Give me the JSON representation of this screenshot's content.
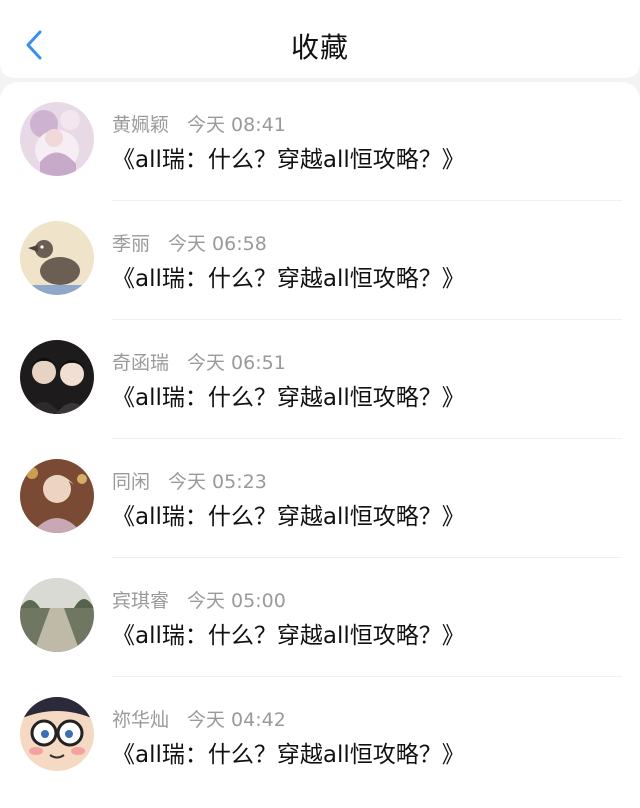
{
  "header": {
    "title": "收藏",
    "back_icon": "chevron-left-icon",
    "accent_color": "#3a8ef0"
  },
  "items": [
    {
      "name": "黄姵颖",
      "time": "今天 08:41",
      "message": "《all瑞：什么？穿越all恒攻略？》",
      "avatar": "anime-girl-pink"
    },
    {
      "name": "季丽",
      "time": "今天 06:58",
      "message": "《all瑞：什么？穿越all恒攻略？》",
      "avatar": "duck-cartoon"
    },
    {
      "name": "奇函瑞",
      "time": "今天 06:51",
      "message": "《all瑞：什么？穿越all恒攻略？》",
      "avatar": "two-people-photo"
    },
    {
      "name": "同闲",
      "time": "今天 05:23",
      "message": "《all瑞：什么？穿越all恒攻略？》",
      "avatar": "person-photo"
    },
    {
      "name": "宾琪睿",
      "time": "今天 05:00",
      "message": "《all瑞：什么？穿越all恒攻略？》",
      "avatar": "road-landscape"
    },
    {
      "name": "祢华灿",
      "time": "今天 04:42",
      "message": "《all瑞：什么？穿越all恒攻略？》",
      "avatar": "anime-boy-glasses"
    }
  ]
}
